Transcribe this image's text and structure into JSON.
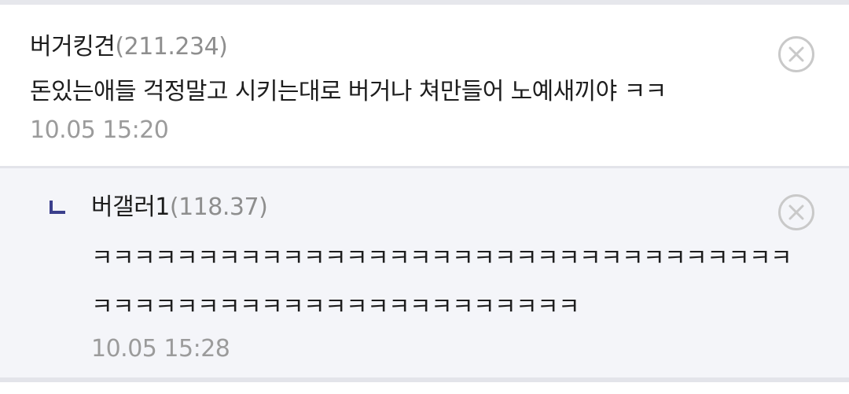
{
  "comment": {
    "nickname": "버거킹견",
    "ip": "(211.234)",
    "text": "돈있는애들 걱정말고 시키는대로 버거나 쳐만들어 노예새끼야 ㅋㅋ",
    "timestamp": "10.05 15:20",
    "delete_icon": "close-circle-icon"
  },
  "reply": {
    "arrow_icon": "reply-arrow-icon",
    "nickname": "버갤러1",
    "ip": "(118.37)",
    "text": "ㅋㅋㅋㅋㅋㅋㅋㅋㅋㅋㅋㅋㅋㅋㅋㅋㅋㅋㅋㅋㅋㅋㅋㅋㅋㅋㅋㅋㅋㅋㅋㅋㅋㅋㅋㅋㅋㅋㅋㅋㅋㅋㅋㅋㅋㅋㅋㅋㅋㅋㅋㅋㅋㅋㅋㅋ",
    "timestamp": "10.05 15:28",
    "delete_icon": "close-circle-icon"
  },
  "colors": {
    "reply_arrow": "#3b3f8c",
    "reply_background": "#f4f5f9",
    "divider": "#e3e4ea"
  }
}
